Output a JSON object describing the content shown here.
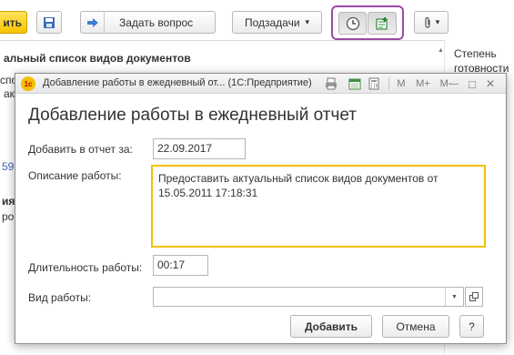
{
  "background": {
    "toolbar": {
      "primary_button_label": "ить",
      "ask_question_label": "Задать вопрос",
      "subtasks_label": "Подзадачи",
      "dropdown_arrow": "▾",
      "more_label": "▾"
    },
    "content": {
      "heading_fragment": "альный список видов документов",
      "line_fragment_1": "спо",
      "line_fragment_2": "ак",
      "link_fragment": "59",
      "bold_fragment": "ия",
      "line_fragment_3": "ро",
      "side_label_1": "Степень",
      "side_label_2": "готовности"
    }
  },
  "dialog": {
    "logo_text": "1с",
    "window_title": "Добавление работы в ежедневный от... (1С:Предприятие)",
    "titlebar_glyphs": {
      "m": "M",
      "m_plus": "M+",
      "m_minus": "M-",
      "minimize": "—",
      "maximize": "□",
      "close": "✕"
    },
    "heading": "Добавление работы в ежедневный отчет",
    "date_label": "Добавить в отчет за:",
    "date_value": "22.09.2017",
    "description_label": "Описание работы:",
    "description_value": "Предоставить актуальный список видов документов от\n15.05.2011 17:18:31",
    "duration_label": "Длительность работы:",
    "duration_value": "00:17",
    "work_type_label": "Вид работы:",
    "work_type_value": "",
    "add_button": "Добавить",
    "cancel_button": "Отмена",
    "help_button": "?"
  }
}
